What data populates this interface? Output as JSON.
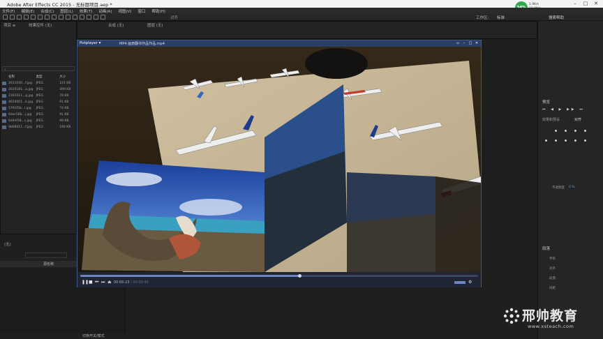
{
  "window": {
    "title": "Adobe After Effects CC 2015 - 无标题项目.aep *",
    "controls": [
      "–",
      "□",
      "✕"
    ]
  },
  "menu": [
    "文件(F)",
    "编辑(E)",
    "合成(C)",
    "图层(L)",
    "效果(T)",
    "动画(A)",
    "视图(V)",
    "窗口",
    "帮助(H)"
  ],
  "toolbar": {
    "workspace_label": "工作区:",
    "workspace_value": "标准",
    "search_placeholder": "搜索帮助"
  },
  "system": {
    "net_percent": "34%",
    "up": "1.9K/s",
    "down": "23.0K/s"
  },
  "project_panel": {
    "tab_project": "项目 ≡",
    "tab_effects": "效果控件 (无)",
    "columns": [
      "名称",
      "类型",
      "大小"
    ],
    "rows": [
      {
        "name": "2011040...f.jpg",
        "type": "JPEG",
        "size": "101 KB"
      },
      {
        "name": "2020181...a.jpg",
        "type": "JPEG",
        "size": "499 KB"
      },
      {
        "name": "2161011...g.jpg",
        "type": "JPEG",
        "size": "78 KB"
      },
      {
        "name": "4654001...k.jpg",
        "type": "JPEG",
        "size": "91 KB"
      },
      {
        "name": "5791f5b...l.jpg",
        "type": "JPEG",
        "size": "74 KB"
      },
      {
        "name": "6dac58b...j.jpg",
        "type": "JPEG",
        "size": "91 KB"
      },
      {
        "name": "6d4ef28...s.jpg",
        "type": "JPEG",
        "size": "99 KB"
      },
      {
        "name": "9b68011...f.jpg",
        "type": "JPEG",
        "size": "166 KB"
      }
    ],
    "bpc": "8 bpc"
  },
  "comp_panel": {
    "tab_comp": "合成 (无)",
    "tab_layer": "图层 (无)"
  },
  "timeline": {
    "tab": "(无)",
    "layer_col": "源名称",
    "bottom_label": "切换开关/模式"
  },
  "right_panel": {
    "preview": "预览",
    "effects": "效果和预设",
    "align": "对齐",
    "paragraph": "段落",
    "opacity_label": "不透明度",
    "opacity_value": "0 %",
    "text_items": [
      "字符",
      "对齐",
      "段落",
      "间距"
    ]
  },
  "player": {
    "app_name": "Potplayer ▾",
    "file_name": "MP4  画册翻书作品作品.mp4",
    "time_current": "00:00:23",
    "time_total": "00:00:46",
    "progress": 0.55
  },
  "watermark": {
    "text": "邢帅教育",
    "url": "www.xsteach.com"
  },
  "colors": {
    "accent": "#2b3f66",
    "panel": "#232323",
    "net": "#2fa84f"
  }
}
